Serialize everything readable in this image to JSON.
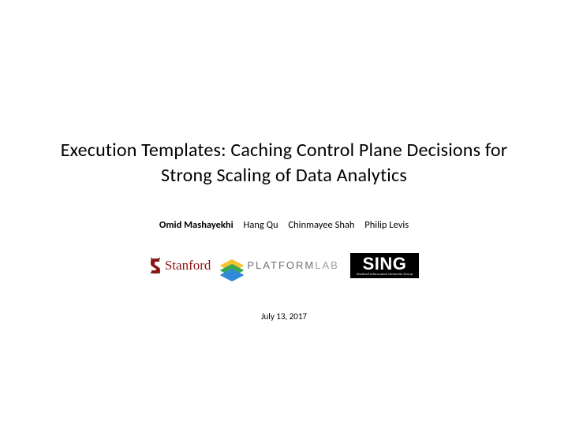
{
  "title_line1": "Execution Templates: Caching Control Plane Decisions for",
  "title_line2": "Strong Scaling of Data Analytics",
  "authors": {
    "lead": "Omid Mashayekhi",
    "others": [
      "Hang Qu",
      "Chinmayee Shah",
      "Philip Levis"
    ]
  },
  "logos": {
    "stanford": "Stanford",
    "platformlab_part1": "PLATFORM",
    "platformlab_part2": "LAB",
    "sing_main": "SING",
    "sing_sub": "Stanford Information Networks Group"
  },
  "date": "July 13, 2017"
}
